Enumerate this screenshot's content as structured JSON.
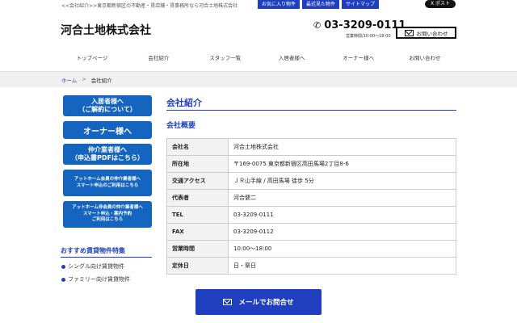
{
  "header": {
    "tagline": "<<会社紹介>>東京都新宿区の不動産・賃店舗・賃事務所なら河合土地株式会社",
    "top_links": [
      "お気に入り物件",
      "最近見た物件",
      "サイトマップ"
    ],
    "x_post": "X ポスト",
    "logo": "河合土地株式会社",
    "phone": "03-3209-0111",
    "hours": "営業時間/10:00～18:00",
    "contact_label": "お問い合わせ"
  },
  "nav": [
    "トップページ",
    "会社紹介",
    "スタッフ一覧",
    "入居者様へ",
    "オーナー様へ",
    "お問い合わせ"
  ],
  "breadcrumb": {
    "home": "ホーム",
    "separator": ">",
    "current": "会社紹介"
  },
  "sidebar": {
    "buttons": [
      {
        "line1": "入居者様へ",
        "line2": "（ご解約について）"
      },
      {
        "line1": "オーナー様へ",
        "line2": ""
      },
      {
        "line1": "仲介業者様へ",
        "line2": "（申込書PDFはこちら）"
      },
      {
        "line1": "アットホーム会員の仲介業者様へ",
        "line2": "スマート申込のご利用はこちら",
        "line3": ""
      },
      {
        "line1": "アットホーム非会員の仲介業者様へ",
        "line2": "スマート申込・案内予約",
        "line3": "ご利用はこちら"
      }
    ],
    "recommended_title": "おすすめ賃貸物件特集",
    "recommended_items": [
      "シングル向け賃貸物件",
      "ファミリー向け賃貸物件"
    ]
  },
  "main": {
    "title": "会社紹介",
    "subtitle": "会社概要",
    "table": [
      {
        "label": "会社名",
        "value": "河合土地株式会社"
      },
      {
        "label": "所在地",
        "value": "〒169-0075 東京都新宿区高田馬場2丁目8-6"
      },
      {
        "label": "交通アクセス",
        "value": "ＪＲ山手線 / 高田馬場 徒歩 5分"
      },
      {
        "label": "代表者",
        "value": "河合健二"
      },
      {
        "label": "TEL",
        "value": "03-3209-0111"
      },
      {
        "label": "FAX",
        "value": "03-3209-0112"
      },
      {
        "label": "営業時間",
        "value": "10:00～18:00"
      },
      {
        "label": "定休日",
        "value": "日・祭日"
      }
    ]
  },
  "cta": {
    "label": "メールでお問合せ"
  }
}
